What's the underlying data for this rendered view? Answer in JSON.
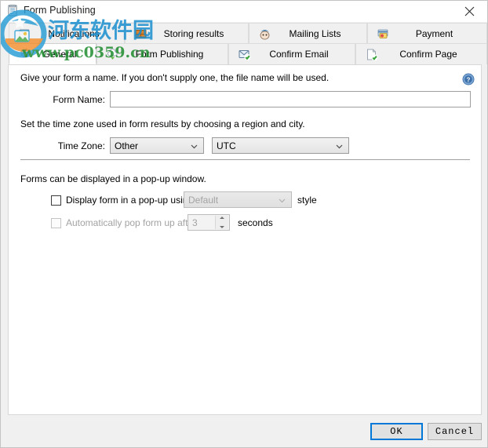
{
  "window": {
    "title": "Form Publishing",
    "title_icon": "form-document-icon",
    "close_icon": "close-icon"
  },
  "tabs": {
    "top_row": [
      {
        "label": "Notifications",
        "icon": "bell-notification-icon",
        "selected": false
      },
      {
        "label": "Storing results",
        "icon": "database-box-icon",
        "selected": false
      },
      {
        "label": "Mailing Lists",
        "icon": "mailchimp-monkey-icon",
        "selected": false
      },
      {
        "label": "Payment",
        "icon": "credit-card-icon",
        "selected": false
      }
    ],
    "bottom_row": [
      {
        "label": "General",
        "icon": "gear-icon",
        "selected": true
      },
      {
        "label": "Form Publishing",
        "icon": "cloud-upload-icon",
        "selected": false
      },
      {
        "label": "Confirm Email",
        "icon": "email-check-icon",
        "selected": false
      },
      {
        "label": "Confirm Page",
        "icon": "page-check-icon",
        "selected": false
      }
    ]
  },
  "content": {
    "form_name_description": "Give your form a name. If you don't supply one, the file name will be used.",
    "help_icon": "help-question-icon",
    "form_name_label": "Form Name:",
    "form_name_value": "",
    "form_name_placeholder": "",
    "time_zone_description": "Set the time zone used in form results by choosing a region and city.",
    "time_zone_label": "Time Zone:",
    "time_zone_region": "Other",
    "time_zone_city": "UTC",
    "popup_description": "Forms can be displayed in a pop-up window.",
    "popup_checkbox_label": "Display form in a pop-up using",
    "popup_checkbox_checked": false,
    "popup_style_value": "Default",
    "popup_style_suffix": "style",
    "auto_popup_checkbox_label": "Automatically pop form up after",
    "auto_popup_checkbox_checked": false,
    "auto_popup_seconds_value": "3",
    "auto_popup_suffix": "seconds"
  },
  "footer": {
    "ok_label": "OK",
    "cancel_label": "Cancel"
  },
  "watermark": {
    "site_name": "河东软件园",
    "site_url": "www.pc0359.cn"
  },
  "colors": {
    "accent": "#0078d7",
    "window_bg": "#f0f0f0",
    "panel_bg": "#ffffff",
    "watermark_blue": "#2e9fd6",
    "watermark_orange": "#f08a24",
    "watermark_green": "#2e8b2e"
  }
}
